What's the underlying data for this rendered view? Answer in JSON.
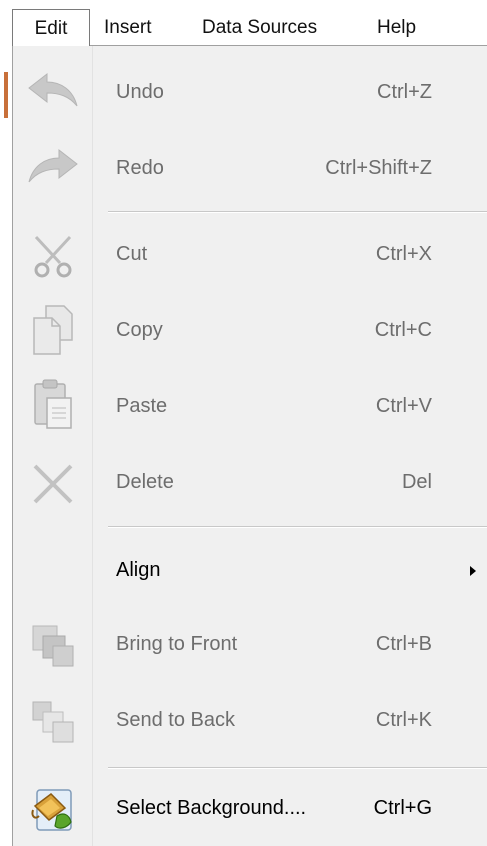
{
  "menubar": {
    "items": [
      {
        "label": "Edit"
      },
      {
        "label": "Insert"
      },
      {
        "label": "Data Sources"
      },
      {
        "label": "Help"
      }
    ]
  },
  "menu": {
    "undo": {
      "label": "Undo",
      "shortcut": "Ctrl+Z",
      "icon": "undo-icon"
    },
    "redo": {
      "label": "Redo",
      "shortcut": "Ctrl+Shift+Z",
      "icon": "redo-icon"
    },
    "cut": {
      "label": "Cut",
      "shortcut": "Ctrl+X",
      "icon": "scissors-icon"
    },
    "copy": {
      "label": "Copy",
      "shortcut": "Ctrl+C",
      "icon": "copy-icon"
    },
    "paste": {
      "label": "Paste",
      "shortcut": "Ctrl+V",
      "icon": "paste-icon"
    },
    "delete": {
      "label": "Delete",
      "shortcut": "Del",
      "icon": "delete-icon"
    },
    "align": {
      "label": "Align"
    },
    "bring_front": {
      "label": "Bring to Front",
      "shortcut": "Ctrl+B",
      "icon": "bring-to-front-icon"
    },
    "send_back": {
      "label": "Send to Back",
      "shortcut": "Ctrl+K",
      "icon": "send-to-back-icon"
    },
    "select_bg": {
      "label": "Select Background....",
      "shortcut": "Ctrl+G",
      "icon": "paint-bucket-icon"
    }
  },
  "colors": {
    "menu_bg": "#f0f0f0",
    "disabled_text": "#6d6d6d",
    "disabled_icon": "#c4c4c4"
  }
}
